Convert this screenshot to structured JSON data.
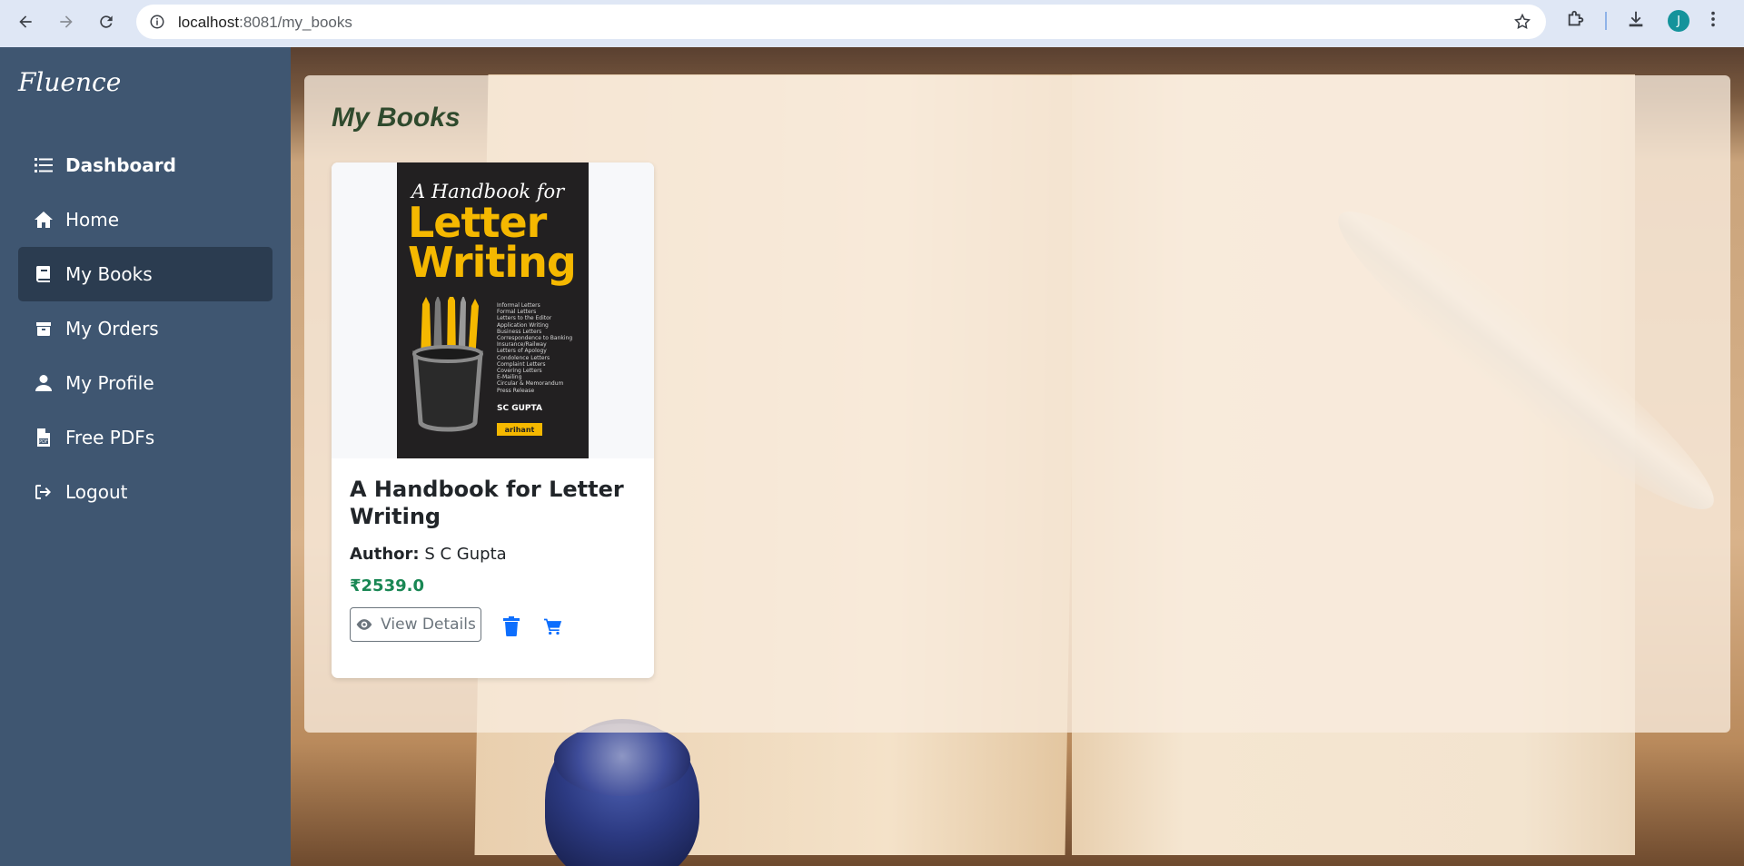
{
  "browser": {
    "url_host": "localhost",
    "url_path": ":8081/my_books",
    "profile_initial": "J"
  },
  "sidebar": {
    "brand": "Fluence",
    "items": [
      {
        "label": "Dashboard",
        "icon": "list-icon"
      },
      {
        "label": "Home",
        "icon": "home-icon"
      },
      {
        "label": "My Books",
        "icon": "book-icon"
      },
      {
        "label": "My Orders",
        "icon": "box-icon"
      },
      {
        "label": "My Profile",
        "icon": "user-icon"
      },
      {
        "label": "Free PDFs",
        "icon": "pdf-file-icon"
      },
      {
        "label": "Logout",
        "icon": "logout-icon"
      }
    ],
    "active": "My Books"
  },
  "main": {
    "title": "My Books",
    "books": [
      {
        "title": "A Handbook for Letter Writing",
        "author_label": "Author:",
        "author": "S C Gupta",
        "price": "₹2539.0",
        "view_label": "View Details",
        "cover": {
          "line1": "A Handbook for",
          "line2": "Letter Writing",
          "topics": [
            "Informal Letters",
            "Formal Letters",
            "Letters to the Editor",
            "Application Writing",
            "Business Letters",
            "Correspondence to Banking",
            "Insurance/Railway",
            "Letters of Apology",
            "Condolence Letters",
            "Complaint Letters",
            "Covering Letters",
            "E-Mailing",
            "Circular & Memorandum",
            "Press Release"
          ],
          "author": "SC GUPTA",
          "publisher": "arihant"
        }
      }
    ]
  },
  "colors": {
    "sidebar_bg": "#3f5671",
    "sidebar_active": "#2b3c50",
    "title_green": "#2f4a2d",
    "price_green": "#198754",
    "icon_blue": "#0d6efd",
    "cover_yellow": "#f5b800"
  }
}
